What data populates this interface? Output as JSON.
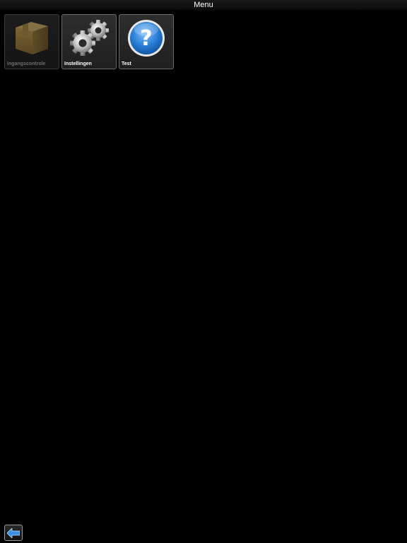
{
  "header": {
    "title": "Menu"
  },
  "menu": {
    "tiles": [
      {
        "label": "Ingangscontrole",
        "icon": "box-icon",
        "enabled": false
      },
      {
        "label": "Instellingen",
        "icon": "gears-icon",
        "enabled": true
      },
      {
        "label": "Test",
        "icon": "question-icon",
        "enabled": true
      }
    ]
  },
  "footer": {
    "back_icon": "arrow-left-icon"
  },
  "colors": {
    "background": "#000000",
    "tile_border": "#6a6a6a",
    "question_blue": "#1e6fc9",
    "back_arrow": "#3a8fe0"
  }
}
